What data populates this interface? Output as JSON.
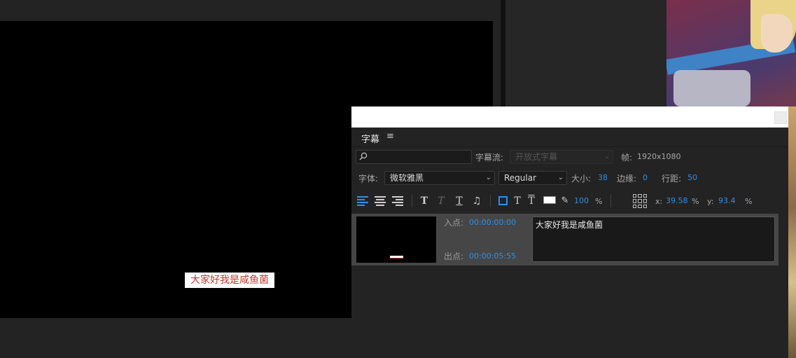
{
  "overlay_caption": "大家好我是咸鱼菌",
  "captions_panel": {
    "tab_label": "字幕",
    "menu_icon": "≡",
    "search": {
      "icon": "search-icon",
      "value": "",
      "placeholder": ""
    },
    "stream_label": "字幕流:",
    "stream_value": "开放式字幕",
    "frame_label": "帧:",
    "frame_value": "1920x1080",
    "font_label": "字体:",
    "font_value": "微软雅黑",
    "style_value": "Regular",
    "size_label": "大小:",
    "size_value": "38",
    "edge_label": "边缘:",
    "edge_value": "0",
    "line_spacing_label": "行距:",
    "line_spacing_value": "50",
    "opacity_value": "100",
    "opacity_unit": "%",
    "x_label": "x:",
    "x_value": "39.58",
    "x_unit": "%",
    "y_label": "y:",
    "y_value": "93.4",
    "y_unit": "%",
    "colors": {
      "accent": "#2f8fe8",
      "text_fill": "#ffffff"
    },
    "clip": {
      "in_label": "入点:",
      "in_time": "00:00:00:00",
      "out_label": "出点:",
      "out_time": "00:00:05:55",
      "text": "大家好我是咸鱼菌"
    }
  }
}
